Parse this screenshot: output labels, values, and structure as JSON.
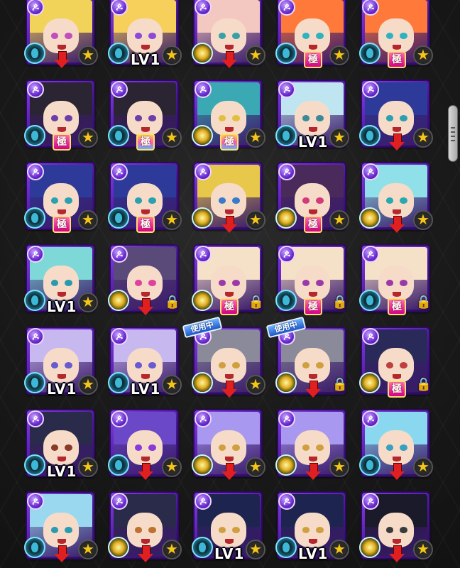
{
  "screen": {
    "title": ""
  },
  "labels": {
    "level": "LV1",
    "kiwame": "極",
    "in_use": "使用中",
    "star": "★",
    "element": "ዾ"
  },
  "colors": {
    "frame_purple": "#6b2bd1",
    "star_gold": "#f5c518",
    "gauge_cyan": "#7fe3ff",
    "in_use_blue": "#1d57c9"
  },
  "cards": [
    {
      "hair": "#f2d35a",
      "eye": "#c04fbd",
      "gauge": "cyan",
      "badge": "arrow",
      "right": "star"
    },
    {
      "hair": "#f6d05a",
      "eye": "#8b4ad8",
      "gauge": "cyan",
      "badge": "lv",
      "right": "star"
    },
    {
      "hair": "#f3c8c0",
      "eye": "#3aa0a8",
      "gauge": "gold",
      "badge": "arrow",
      "right": "star"
    },
    {
      "hair": "#ff7a3a",
      "eye": "#2fb2c0",
      "gauge": "cyan",
      "badge": "kiwame",
      "right": "star"
    },
    {
      "hair": "#ff7a3a",
      "eye": "#2fb2c0",
      "gauge": "cyan",
      "badge": "kiwame",
      "right": "star"
    },
    {
      "hair": "#2a2433",
      "eye": "#6c3fa8",
      "gauge": "cyan",
      "badge": "kiwame-gold",
      "right": "star"
    },
    {
      "hair": "#2a2433",
      "eye": "#6c3fa8",
      "gauge": "cyan",
      "badge": "kiwame-rainbow",
      "right": "star"
    },
    {
      "hair": "#3aa9b3",
      "eye": "#e0c040",
      "gauge": "gold",
      "badge": "kiwame-rainbow",
      "right": "star"
    },
    {
      "hair": "#bfe6f0",
      "eye": "#3a8a9a",
      "gauge": "cyan",
      "badge": "lv",
      "right": "star"
    },
    {
      "hair": "#2d3a9a",
      "eye": "#2aa0b0",
      "gauge": "cyan",
      "badge": "arrow",
      "right": "star"
    },
    {
      "hair": "#2d3a9a",
      "eye": "#2aa0b0",
      "gauge": "cyan",
      "badge": "kiwame",
      "right": "star"
    },
    {
      "hair": "#2d3a9a",
      "eye": "#2aa0b0",
      "gauge": "cyan",
      "badge": "kiwame",
      "right": "star"
    },
    {
      "hair": "#e8c84a",
      "eye": "#3a7acc",
      "gauge": "gold",
      "badge": "arrow",
      "right": "star"
    },
    {
      "hair": "#4a2a5a",
      "eye": "#d23a7a",
      "gauge": "gold",
      "badge": "kiwame-gold",
      "right": "star"
    },
    {
      "hair": "#8fe0e8",
      "eye": "#2aa8b0",
      "gauge": "gold",
      "badge": "arrow",
      "right": "star"
    },
    {
      "hair": "#7ed8d8",
      "eye": "#2a9ab0",
      "gauge": "cyan",
      "badge": "lv",
      "right": "star"
    },
    {
      "hair": "#5a4a7a",
      "eye": "#e040a0",
      "gauge": "gold",
      "badge": "arrow",
      "right": "lock"
    },
    {
      "hair": "#f5e0c8",
      "eye": "#9a3aa8",
      "gauge": "gold",
      "badge": "kiwame-gold",
      "right": "lock"
    },
    {
      "hair": "#f5e0c8",
      "eye": "#9a3aa8",
      "gauge": "cyan",
      "badge": "kiwame",
      "right": "lock"
    },
    {
      "hair": "#f5e0c8",
      "eye": "#9a3aa8",
      "gauge": "cyan",
      "badge": "kiwame",
      "right": "lock"
    },
    {
      "hair": "#c8b8f0",
      "eye": "#6a5ad0",
      "gauge": "cyan",
      "badge": "lv",
      "right": "star"
    },
    {
      "hair": "#c8b8f0",
      "eye": "#6a5ad0",
      "gauge": "cyan",
      "badge": "lv",
      "right": "star"
    },
    {
      "hair": "#8a8a9a",
      "eye": "#d0a040",
      "gauge": "gold",
      "badge": "arrow",
      "right": "star",
      "in_use": true
    },
    {
      "hair": "#8a8a9a",
      "eye": "#d0a040",
      "gauge": "gold",
      "badge": "arrow",
      "right": "lock",
      "in_use": true
    },
    {
      "hair": "#2a2a5a",
      "eye": "#c04040",
      "gauge": "gold",
      "badge": "kiwame",
      "right": "lock"
    },
    {
      "hair": "#2a2a4a",
      "eye": "#8a3a2a",
      "gauge": "cyan",
      "badge": "lv",
      "right": "star"
    },
    {
      "hair": "#6a48c8",
      "eye": "#8a3ad8",
      "gauge": "cyan",
      "badge": "arrow",
      "right": "star"
    },
    {
      "hair": "#a898f0",
      "eye": "#d0a040",
      "gauge": "gold",
      "badge": "arrow",
      "right": "star"
    },
    {
      "hair": "#a898f0",
      "eye": "#d0a040",
      "gauge": "gold",
      "badge": "arrow",
      "right": "star"
    },
    {
      "hair": "#8ad8f0",
      "eye": "#3aa0c0",
      "gauge": "cyan",
      "badge": "arrow",
      "right": "star"
    },
    {
      "hair": "#9ad8f0",
      "eye": "#2a9ab0",
      "gauge": "cyan",
      "badge": "arrow",
      "right": "star"
    },
    {
      "hair": "#2a2a4a",
      "eye": "#c07030",
      "gauge": "gold",
      "badge": "arrow",
      "right": "star"
    },
    {
      "hair": "#1e2450",
      "eye": "#d0a040",
      "gauge": "cyan",
      "badge": "lv",
      "right": "star"
    },
    {
      "hair": "#1e2450",
      "eye": "#d0a040",
      "gauge": "cyan",
      "badge": "lv",
      "right": "star"
    },
    {
      "hair": "#1a1a2a",
      "eye": "#3a3a3a",
      "gauge": "gold",
      "badge": "arrow",
      "right": "star"
    }
  ]
}
